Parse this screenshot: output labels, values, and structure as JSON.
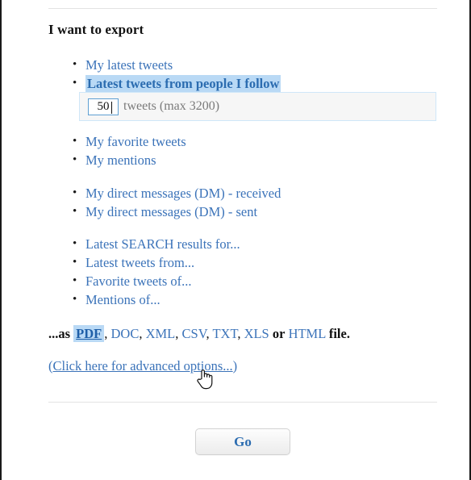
{
  "page": {
    "heading": "I want to export"
  },
  "groups": {
    "a": [
      {
        "label": "My latest tweets",
        "selected": false
      },
      {
        "label": "Latest tweets from people I follow",
        "selected": true
      }
    ],
    "b": [
      {
        "label": "My favorite tweets",
        "selected": false
      },
      {
        "label": "My mentions",
        "selected": false
      }
    ],
    "c": [
      {
        "label": "My direct messages (DM) - received",
        "selected": false
      },
      {
        "label": "My direct messages (DM) - sent",
        "selected": false
      }
    ],
    "d": [
      {
        "label": "Latest SEARCH results for...",
        "selected": false
      },
      {
        "label": "Latest tweets from...",
        "selected": false
      },
      {
        "label": "Favorite tweets of...",
        "selected": false
      },
      {
        "label": "Mentions of...",
        "selected": false
      }
    ]
  },
  "count_panel": {
    "value": "50",
    "placeholder": "50",
    "label": "tweets (max 3200)"
  },
  "format_line": {
    "prefix": "...as",
    "selected_format": "PDF",
    "sep1": ",",
    "formats_middle": [
      "DOC",
      "XML",
      "CSV",
      "TXT",
      "XLS"
    ],
    "or_word": "or",
    "last_format": "HTML",
    "suffix": "file."
  },
  "advanced": {
    "open_paren": "(",
    "link_text": "Click here for advanced options...",
    "close_paren": ")"
  },
  "go_button": {
    "label": "Go"
  },
  "colors": {
    "link_blue": "#3b73b9",
    "selection_highlight": "#b9d9f5",
    "selected_text_blue": "#2b6cb0",
    "panel_bg": "#f6f6f6",
    "panel_border": "#cfe7f8",
    "rule": "#e3e3e3",
    "frame_border": "#1a1a1a"
  },
  "icons": {
    "cursor": "hand-pointer-cursor"
  }
}
